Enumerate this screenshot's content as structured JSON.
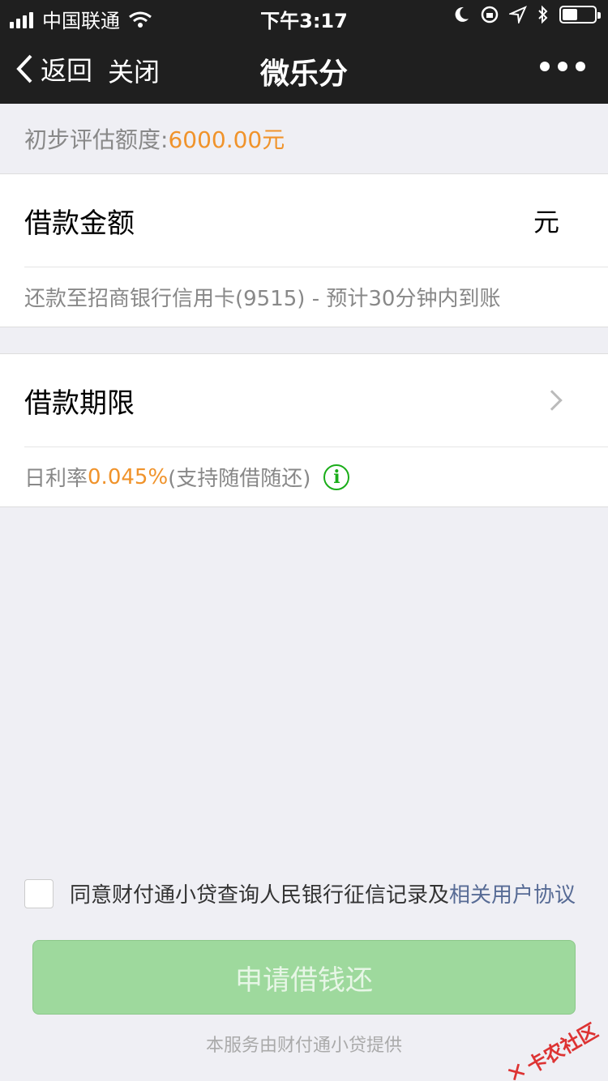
{
  "status_bar": {
    "carrier": "中国联通",
    "time": "下午3:17"
  },
  "nav": {
    "back_label": "返回",
    "close_label": "关闭",
    "title": "微乐分"
  },
  "quota": {
    "label": "初步评估额度:",
    "amount": "6000.00元"
  },
  "loan_amount": {
    "label": "借款金额",
    "unit": "元",
    "repay_info": "还款至招商银行信用卡(9515) - 预计30分钟内到账"
  },
  "loan_term": {
    "label": "借款期限",
    "rate_prefix": "日利率",
    "rate_value": "0.045%",
    "rate_suffix": "(支持随借随还)",
    "info_icon_glyph": "i"
  },
  "agreement": {
    "text": "同意财付通小贷查询人民银行征信记录及",
    "link": "相关用户协议"
  },
  "apply_button": "申请借钱还",
  "footer": "本服务由财付通小贷提供",
  "watermark": "卡农社区",
  "colors": {
    "accent_orange": "#f0932b",
    "button_green": "#9ed99d",
    "link_blue": "#576b95",
    "info_green": "#1aad19"
  }
}
